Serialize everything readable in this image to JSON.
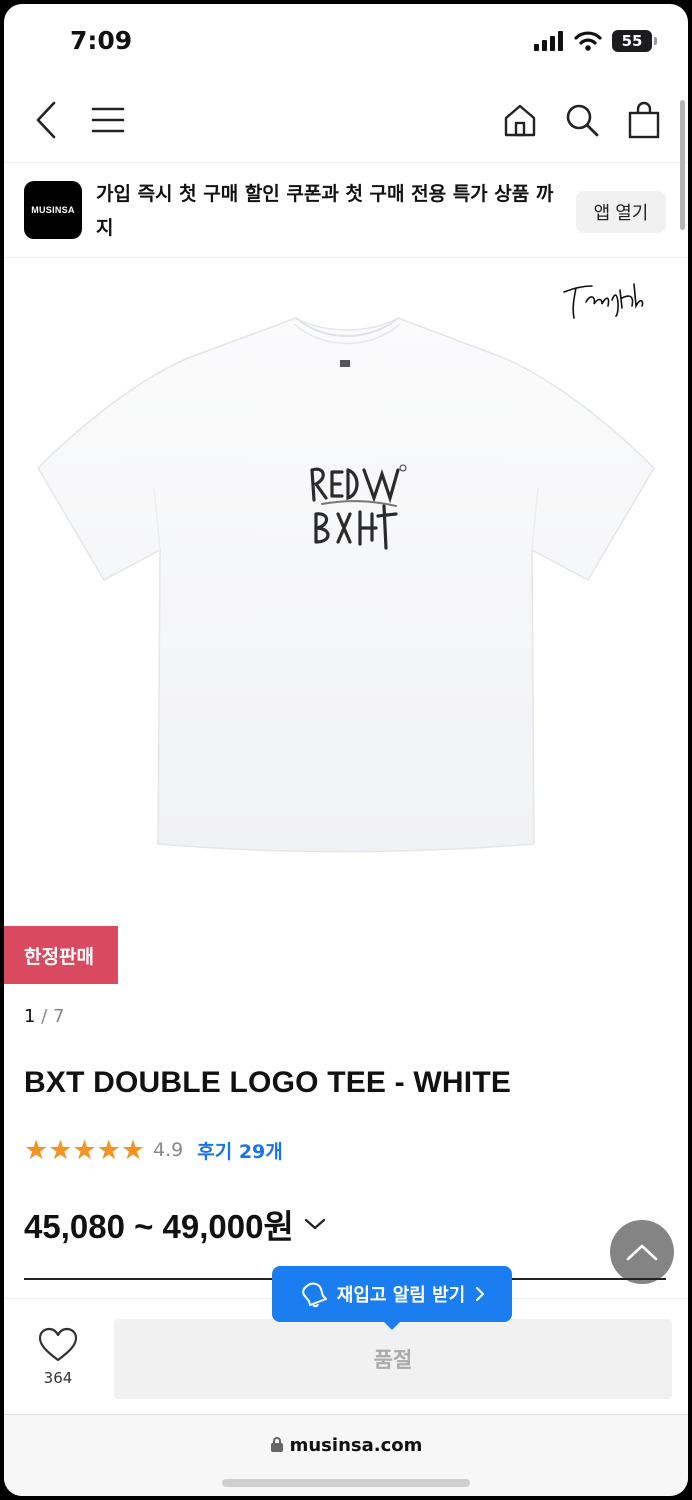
{
  "status_bar": {
    "time": "7:09",
    "battery": "55"
  },
  "nav": {
    "back_icon": "chevron-left-icon",
    "menu_icon": "hamburger-icon",
    "home_icon": "home-icon",
    "search_icon": "search-icon",
    "cart_icon": "shopping-bag-icon"
  },
  "app_banner": {
    "logo_text": "MUSINSA",
    "message": "가입 즉시 첫 구매 할인 쿠폰과 첫 구매 전용 특가 상품 까지",
    "open_button": "앱 열기"
  },
  "product": {
    "signature": "TangHak",
    "badge": "한정판매",
    "image_index": "1",
    "image_total": "/ 7",
    "title": "BXT DOUBLE LOGO TEE - WHITE",
    "stars": "★★★★★",
    "rating": "4.9",
    "reviews": "후기 29개",
    "price": "45,080 ~ 49,000원"
  },
  "actions": {
    "restock_alert": "재입고 알림 받기",
    "like_count": "364",
    "soldout_button": "품절"
  },
  "browser": {
    "url": "musinsa.com"
  },
  "colors": {
    "accent_blue": "#1a7ef0",
    "badge_red": "#d9495f",
    "star_orange": "#f39422"
  }
}
